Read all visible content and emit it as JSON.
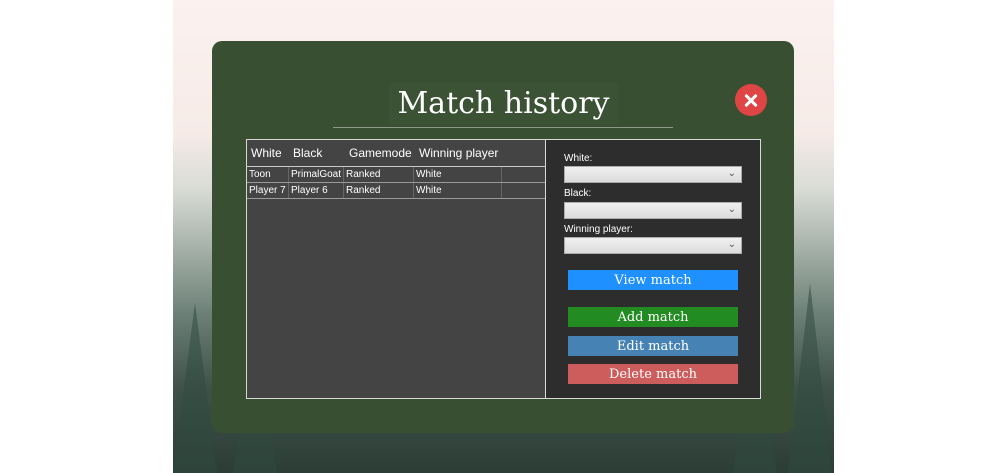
{
  "dialog": {
    "title": "Match history"
  },
  "table": {
    "columns": [
      "White",
      "Black",
      "Gamemode",
      "Winning player"
    ],
    "rows": [
      [
        "Toon",
        "PrimalGoat",
        "Ranked",
        "White"
      ],
      [
        "Player 7",
        "Player 6",
        "Ranked",
        "White"
      ]
    ]
  },
  "filters": {
    "white_label": "White:",
    "white_value": "",
    "black_label": "Black:",
    "black_value": "",
    "winner_label": "Winning player:",
    "winner_value": "",
    "dropdown_glyph": "⌄"
  },
  "actions": {
    "view": "View match",
    "add": "Add match",
    "edit": "Edit match",
    "delete": "Delete match"
  },
  "colors": {
    "window": "#384f31",
    "close": "#e04545",
    "view": "#1e90ff",
    "add": "#228b22",
    "edit": "#4682b4",
    "delete": "#cd5c5c"
  }
}
